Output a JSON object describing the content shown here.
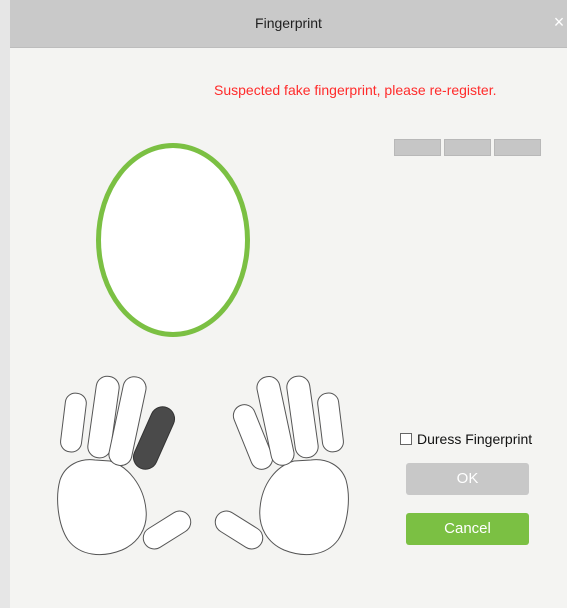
{
  "dialog": {
    "title": "Fingerprint",
    "close_symbol": "×",
    "message": "Suspected fake fingerprint, please re-register.",
    "progress_segments": 3,
    "progress_completed": 0,
    "duress_label": "Duress Fingerprint",
    "duress_checked": false,
    "ok_label": "OK",
    "cancel_label": "Cancel",
    "colors": {
      "accent": "#7bc043",
      "error": "#ff2b2b",
      "disabled_button": "#c8c8c8",
      "progress": "#c6c6c6"
    },
    "selected_finger": "left-index-finger"
  }
}
